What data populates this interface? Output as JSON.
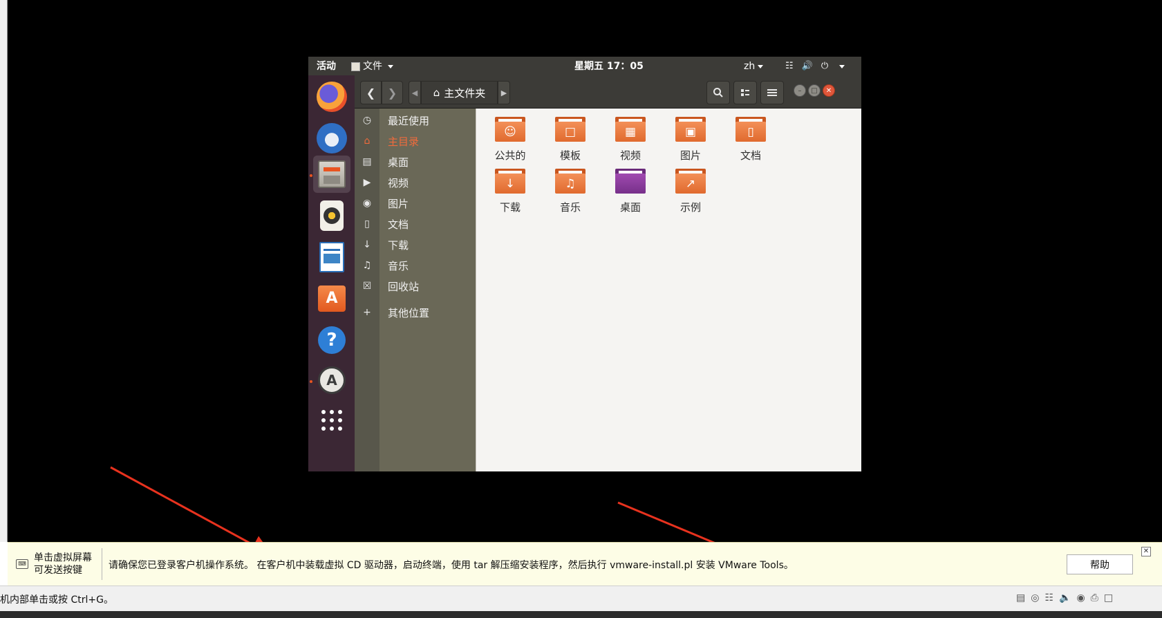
{
  "guest": {
    "topbar": {
      "activities": "活动",
      "files_menu": "文件",
      "clock": "星期五 17：05",
      "lang": "zh"
    },
    "dock": {
      "items": [
        {
          "name": "Firefox",
          "icon": "firefox-icon"
        },
        {
          "name": "Thunderbird",
          "icon": "thunderbird-icon"
        },
        {
          "name": "文件",
          "icon": "files-icon",
          "active": true
        },
        {
          "name": "Rhythmbox",
          "icon": "rhythmbox-icon"
        },
        {
          "name": "LibreOffice Writer",
          "icon": "writer-icon"
        },
        {
          "name": "Ubuntu Software",
          "icon": "software-icon"
        },
        {
          "name": "Help",
          "icon": "help-icon"
        },
        {
          "name": "Software Updater",
          "icon": "updater-icon"
        },
        {
          "name": "Show Applications",
          "icon": "app-grid-icon"
        }
      ]
    },
    "nautilus": {
      "path": "主文件夹",
      "sidebar": [
        {
          "label": "最近使用",
          "icon": "recent-icon"
        },
        {
          "label": "主目录",
          "icon": "home-icon",
          "selected": true
        },
        {
          "label": "桌面",
          "icon": "desktop-folder-icon"
        },
        {
          "label": "视频",
          "icon": "video-icon"
        },
        {
          "label": "图片",
          "icon": "camera-icon"
        },
        {
          "label": "文档",
          "icon": "document-icon"
        },
        {
          "label": "下载",
          "icon": "download-icon"
        },
        {
          "label": "音乐",
          "icon": "music-icon"
        },
        {
          "label": "回收站",
          "icon": "trash-icon"
        },
        {
          "label": "其他位置",
          "icon": "plus-icon"
        }
      ],
      "folders": [
        {
          "label": "公共的",
          "icon": "public-folder-icon"
        },
        {
          "label": "模板",
          "icon": "templates-folder-icon"
        },
        {
          "label": "视频",
          "icon": "videos-folder-icon"
        },
        {
          "label": "图片",
          "icon": "pictures-folder-icon"
        },
        {
          "label": "文档",
          "icon": "documents-folder-icon"
        },
        {
          "label": "下载",
          "icon": "downloads-folder-icon"
        },
        {
          "label": "音乐",
          "icon": "music-folder-icon"
        },
        {
          "label": "桌面",
          "icon": "desktop-folder-icon"
        },
        {
          "label": "示例",
          "icon": "examples-folder-icon"
        }
      ]
    }
  },
  "notice": {
    "hint_line1": "单击虚拟屏幕",
    "hint_line2": "可发送按键",
    "message": "请确保您已登录客户机操作系统。 在客户机中装载虚拟 CD 驱动器，启动终端，使用 tar 解压缩安装程序，然后执行 vmware-install.pl 安装 VMware Tools。",
    "help_button": "帮助"
  },
  "statusbar": {
    "text": "机内部单击或按 Ctrl+G。"
  },
  "colors": {
    "ubuntu_orange": "#e95420",
    "annotation_arrow": "#e8321e",
    "notice_bg": "#fdfde6"
  }
}
